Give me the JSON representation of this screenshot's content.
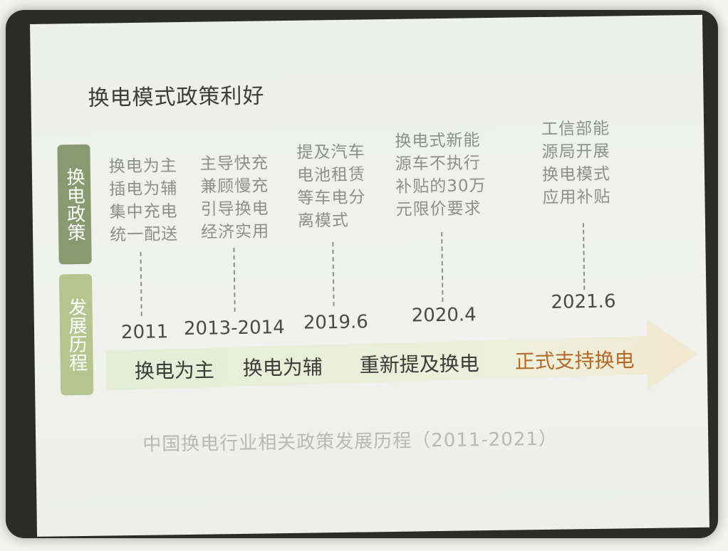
{
  "slide": {
    "title": "换电模式政策利好",
    "side_tags": {
      "policy": "换电政策",
      "history": "发展历程"
    },
    "events": [
      {
        "text": "换电为主插电为辅集中充电统一配送",
        "year": "2011"
      },
      {
        "text": "主导快充兼顾慢充引导换电经济实用",
        "year": "2013-2014"
      },
      {
        "text": "提及汽车电池租赁等车电分离模式",
        "year": "2019.6"
      },
      {
        "text": "换电式新能源车不执行补贴的30万元限价要求",
        "year": "2020.4"
      },
      {
        "text": "工信部能源局开展换电模式应用补贴",
        "year": "2021.6"
      }
    ],
    "stages": [
      "换电为主",
      "换电为辅",
      "重新提及换电",
      "正式支持换电"
    ],
    "caption": "中国换电行业相关政策发展历程（2011-2021）"
  },
  "colors": {
    "policy_tag": "#8a9a70",
    "history_tag": "#b5c58f",
    "arrow_start": "#e5edd6",
    "arrow_end": "#f2e7cf",
    "stage_text": "#3b3c39",
    "stage_highlight": "#b46a2a"
  }
}
